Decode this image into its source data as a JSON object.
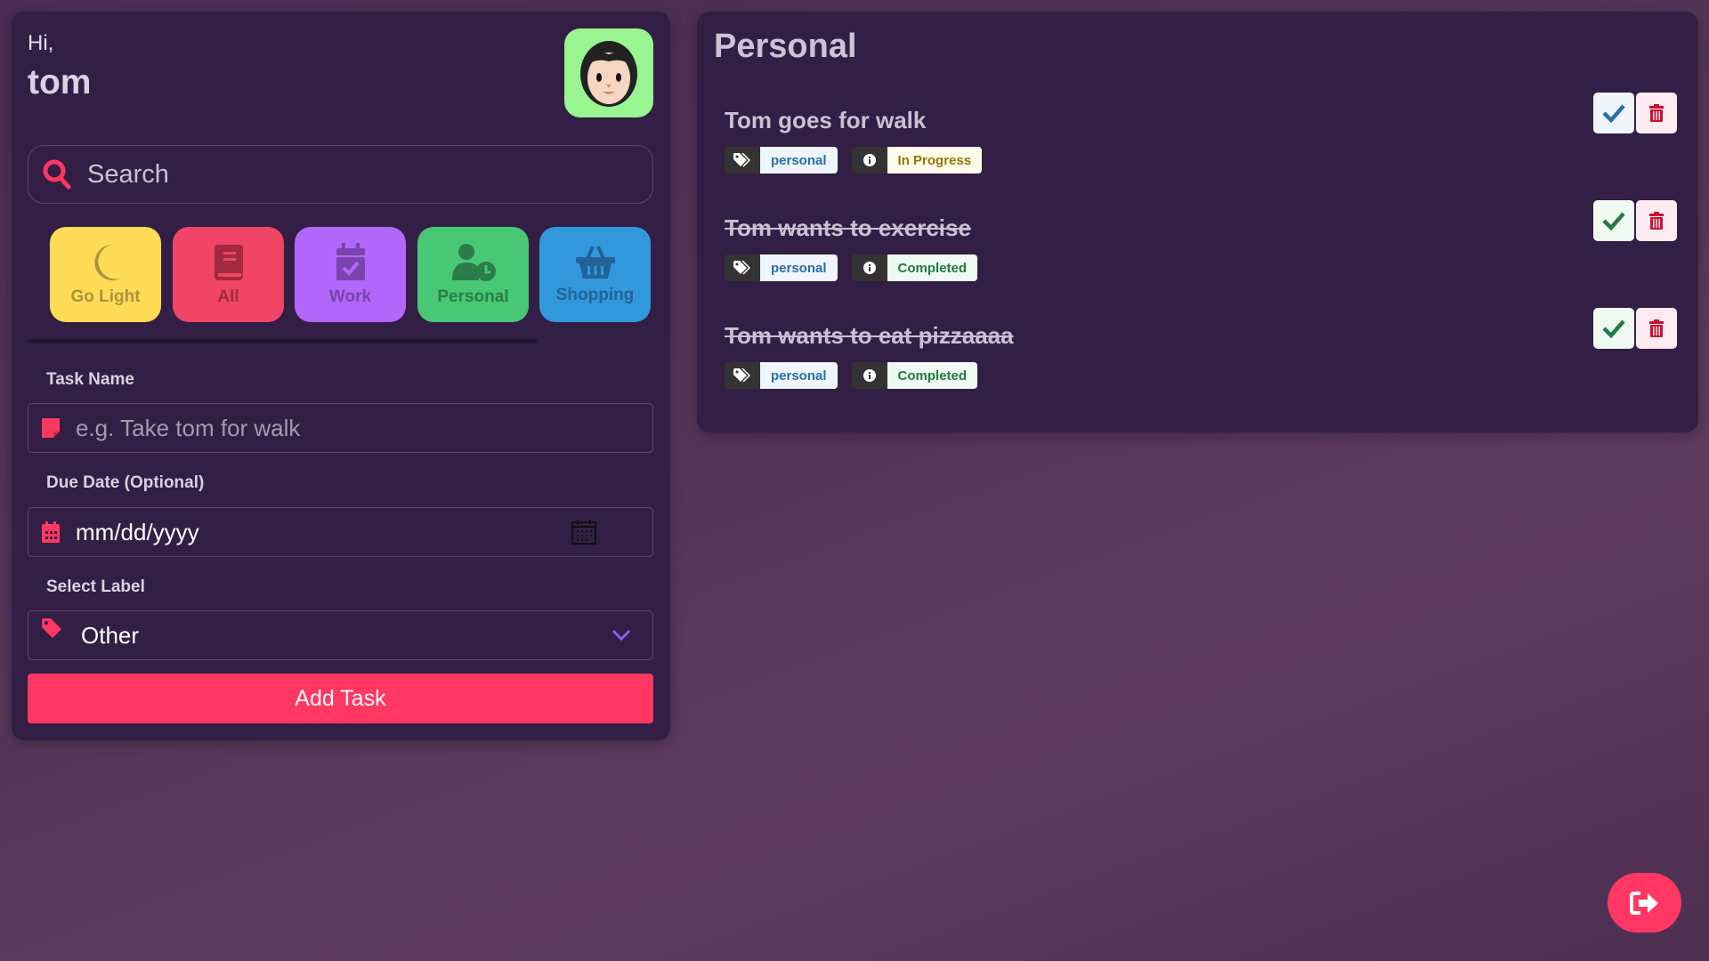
{
  "greeting": "Hi,",
  "user_name": "tom",
  "search": {
    "placeholder": "Search"
  },
  "categories": [
    {
      "label": "Go Light",
      "bg": "#ffdc55",
      "fg": "#a99440"
    },
    {
      "label": "All",
      "bg": "#f04565",
      "fg": "#a32a41"
    },
    {
      "label": "Work",
      "bg": "#b366fa",
      "fg": "#7a44ad"
    },
    {
      "label": "Personal",
      "bg": "#48c774",
      "fg": "#2b7d49"
    },
    {
      "label": "Shopping",
      "bg": "#3298dc",
      "fg": "#22649a"
    }
  ],
  "form": {
    "task_name_label": "Task Name",
    "task_name_placeholder": "e.g. Take tom for walk",
    "due_date_label": "Due Date (Optional)",
    "due_date_placeholder": "mm/dd/yyyy",
    "select_label": "Select Label",
    "selected_label": "Other",
    "add_button": "Add Task"
  },
  "list": {
    "title": "Personal",
    "tasks": [
      {
        "title": "Tom goes for walk",
        "label": "personal",
        "status": "In Progress",
        "done": false
      },
      {
        "title": "Tom wants to exercise",
        "label": "personal",
        "status": "Completed",
        "done": true
      },
      {
        "title": "Tom wants to eat pizzaaaa",
        "label": "personal",
        "status": "Completed",
        "done": true
      }
    ]
  },
  "colors": {
    "accent": "#ff3762",
    "panel": "#331f45"
  }
}
